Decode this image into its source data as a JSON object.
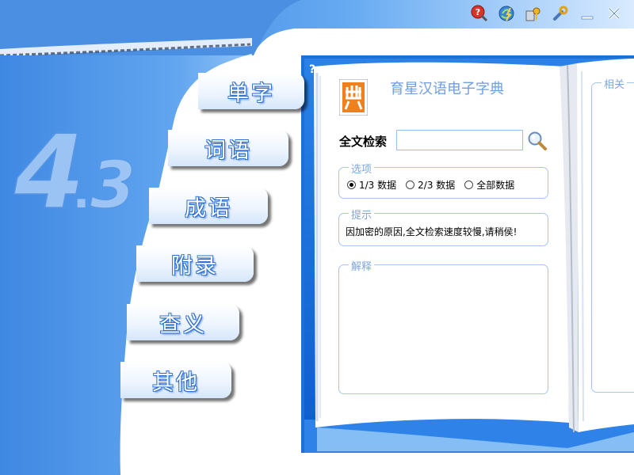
{
  "app": {
    "title": "育星汉语电子字典",
    "version_badge": "4.3",
    "help_label": "?"
  },
  "toolbar": [
    {
      "name": "help-icon",
      "color": "#d9342b"
    },
    {
      "name": "update-icon",
      "color": "#3b86d6"
    },
    {
      "name": "register-icon",
      "color": "#e0a020"
    },
    {
      "name": "settings-icon",
      "color": "#4a78b8"
    },
    {
      "name": "minimize-icon",
      "color": "#ffffff"
    },
    {
      "name": "close-icon",
      "color": "#ffffff"
    }
  ],
  "nav": {
    "items": [
      "单字",
      "词语",
      "成语",
      "附录",
      "查义",
      "其他"
    ]
  },
  "search": {
    "label": "全文检索",
    "value": "",
    "placeholder": ""
  },
  "options": {
    "legend": "选项",
    "items": [
      {
        "label": "1/3 数据",
        "checked": true
      },
      {
        "label": "2/3 数据",
        "checked": false
      },
      {
        "label": "全部数据",
        "checked": false
      }
    ]
  },
  "tips": {
    "legend": "提示",
    "text": "因加密的原因,全文检索速度较慢,请稍侯!"
  },
  "explain": {
    "legend": "解释"
  },
  "related": {
    "legend": "相关"
  },
  "colors": {
    "accent_blue": "#3f87e0",
    "deep_blue": "#1c66c8",
    "legend_blue": "#7fa6db",
    "logo_orange": "#f0801c"
  }
}
